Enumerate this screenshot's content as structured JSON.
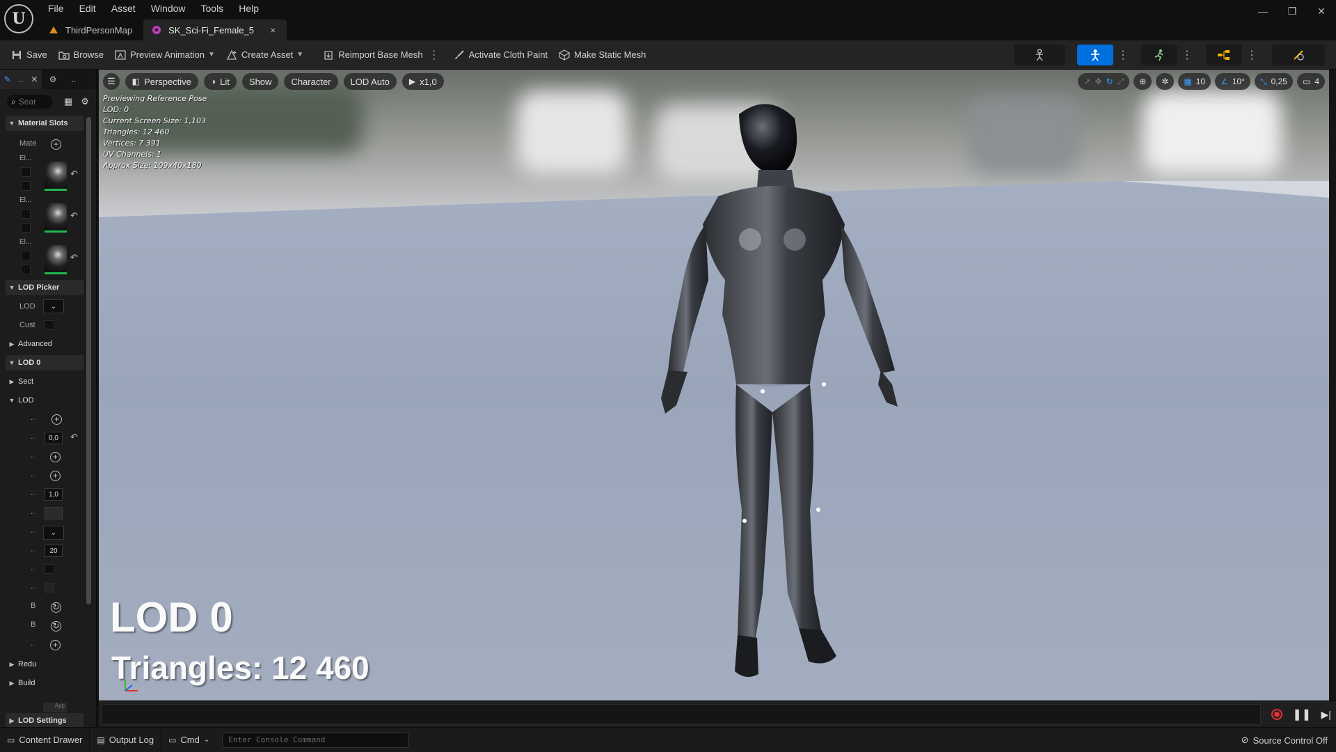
{
  "menu": [
    "File",
    "Edit",
    "Asset",
    "Window",
    "Tools",
    "Help"
  ],
  "tabs": [
    {
      "label": "ThirdPersonMap",
      "icon": "level-icon"
    },
    {
      "label": "SK_Sci-Fi_Female_5",
      "icon": "skeletal-mesh-icon",
      "close": "×"
    }
  ],
  "window": {
    "minimize": "—",
    "maximize": "❐",
    "close": "✕"
  },
  "toolbar": {
    "save": "Save",
    "browse": "Browse",
    "preview_animation": "Preview Animation",
    "create_asset": "Create Asset",
    "reimport": "Reimport Base Mesh",
    "cloth_paint": "Activate Cloth Paint",
    "static_mesh": "Make Static Mesh"
  },
  "left_panel": {
    "tab1": "..",
    "tab2": "..",
    "search_placeholder": "Sear",
    "material_slots": "Material Slots",
    "mate_label": "Mate",
    "el_label": "El...",
    "lod_picker": "LOD Picker",
    "lod_label": "LOD",
    "cust_label": "Cust",
    "advanced": "Advanced",
    "lod0": "LOD 0",
    "sect": "Sect",
    "lod_sub": "LOD",
    "value1": "0,0",
    "value2": "1,0",
    "value3": "20",
    "b_label": "B",
    "redu": "Redu",
    "build": "Build",
    "apply": "App",
    "lod_settings": "LOD Settings",
    "dots": ".."
  },
  "viewport": {
    "menu_icon": "hamburger-icon",
    "perspective": "Perspective",
    "lit": "Lit",
    "show": "Show",
    "character": "Character",
    "lod_auto": "LOD Auto",
    "speed": "x1,0",
    "grid_snap": "10",
    "rot_snap": "10°",
    "scale_snap": "0,25",
    "camera_speed": "4",
    "stats": [
      "Previewing Reference Pose",
      "LOD: 0",
      "Current Screen Size: 1,103",
      "Triangles: 12 460",
      "Vertices: 7 391",
      "UV Channels: 1",
      "Approx Size: 109x40x180"
    ],
    "big_lod": "LOD 0",
    "big_triangles": "Triangles: 12 460"
  },
  "statusbar": {
    "content_drawer": "Content Drawer",
    "output_log": "Output Log",
    "cmd": "Cmd",
    "console_placeholder": "Enter Console Command",
    "source_control": "Source Control Off"
  },
  "colors": {
    "accent": "#0070e0",
    "mesh_ok": "#1fb84e",
    "record": "#dd3333"
  }
}
